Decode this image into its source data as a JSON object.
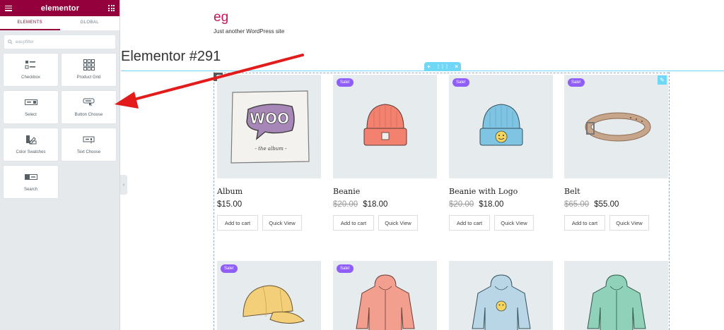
{
  "sidebar": {
    "brand": "elementor",
    "tabs": [
      "ELEMENTS",
      "GLOBAL"
    ],
    "search_placeholder": "easyfilter",
    "widgets": [
      {
        "label": "Checkbox",
        "icon": "checkbox-list-icon"
      },
      {
        "label": "Product Grid",
        "icon": "product-grid-icon"
      },
      {
        "label": "Select",
        "icon": "select-dropdown-icon"
      },
      {
        "label": "Button Choose",
        "icon": "button-choose-icon"
      },
      {
        "label": "Color Swatches",
        "icon": "color-swatches-icon"
      },
      {
        "label": "Text Choose",
        "icon": "text-choose-icon"
      },
      {
        "label": "Search",
        "icon": "search-widget-icon"
      }
    ]
  },
  "site": {
    "title": "eg",
    "tagline": "Just another WordPress site",
    "page_title": "Elementor #291"
  },
  "section_handle": {
    "add": "+",
    "move": "⋮⋮⋮",
    "close": "×"
  },
  "colors": {
    "brand": "#93003c",
    "accent": "#71d7f7",
    "sale_badge": "#8f5ef8",
    "title": "#c2185b"
  },
  "products": [
    {
      "name": "Album",
      "sale": false,
      "old_price": "",
      "price": "$15.00",
      "image": "woo-album-image"
    },
    {
      "name": "Beanie",
      "sale": true,
      "old_price": "$20.00",
      "price": "$18.00",
      "image": "orange-beanie-image"
    },
    {
      "name": "Beanie with Logo",
      "sale": true,
      "old_price": "$20.00",
      "price": "$18.00",
      "image": "blue-beanie-image"
    },
    {
      "name": "Belt",
      "sale": true,
      "old_price": "$65.00",
      "price": "$55.00",
      "image": "brown-belt-image"
    },
    {
      "name": "",
      "sale": true,
      "old_price": "",
      "price": "",
      "image": "yellow-cap-image"
    },
    {
      "name": "",
      "sale": true,
      "old_price": "",
      "price": "",
      "image": "pink-hoodie-image"
    },
    {
      "name": "",
      "sale": false,
      "old_price": "",
      "price": "",
      "image": "blue-hoodie-image"
    },
    {
      "name": "",
      "sale": false,
      "old_price": "",
      "price": "",
      "image": "green-hoodie-image"
    }
  ],
  "labels": {
    "sale": "Sale!",
    "add_to_cart": "Add to cart",
    "quick_view": "Quick View"
  }
}
